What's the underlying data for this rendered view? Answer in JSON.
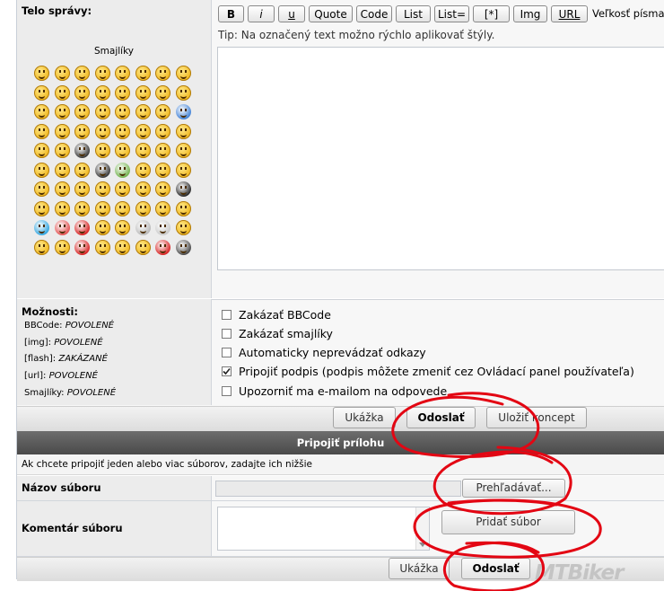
{
  "message_body": {
    "label": "Telo správy:",
    "smileys_title": "Smajlíky",
    "toolbar": {
      "bold": "B",
      "italic": "i",
      "underline": "u",
      "quote": "Quote",
      "code": "Code",
      "list": "List",
      "list_item": "List=",
      "star": "[*]",
      "img": "Img",
      "url": "URL",
      "font_size_label": "Veľkosť písma:"
    },
    "tip": "Tip: Na označený text možno rýchlo aplikovať štýly."
  },
  "options": {
    "label": "Možnosti:",
    "status": [
      {
        "name": "BBCode:",
        "value": "POVOLENÉ"
      },
      {
        "name": "[img]:",
        "value": "POVOLENÉ"
      },
      {
        "name": "[flash]:",
        "value": "ZAKÁZANÉ"
      },
      {
        "name": "[url]:",
        "value": "POVOLENÉ"
      },
      {
        "name": "Smajlíky:",
        "value": "POVOLENÉ"
      }
    ],
    "checkboxes": [
      {
        "label": "Zakázať BBCode",
        "checked": false
      },
      {
        "label": "Zakázať smajlíky",
        "checked": false
      },
      {
        "label": "Automaticky neprevádzať odkazy",
        "checked": false
      },
      {
        "label": "Pripojiť podpis (podpis môžete zmeniť cez Ovládací panel používateľa)",
        "checked": true
      },
      {
        "label": "Upozorniť ma e-mailom na odpovede",
        "checked": false
      }
    ]
  },
  "buttons": {
    "preview": "Ukážka",
    "submit": "Odoslať",
    "save_draft": "Uložiť koncept"
  },
  "attachment": {
    "section_title": "Pripojiť prílohu",
    "info": "Ak chcete pripojiť jeden alebo viac súborov, zadajte ich nižšie",
    "filename_label": "Názov súboru",
    "browse_button": "Prehľadávať...",
    "comment_label": "Komentár súboru",
    "add_file_button": "Pridať súbor",
    "preview": "Ukážka",
    "submit": "Odoslať"
  },
  "watermark": "MTBiker",
  "colors": {
    "annotation_red": "#e30613",
    "section_bar": "#555555",
    "left_cell": "#ececec"
  }
}
